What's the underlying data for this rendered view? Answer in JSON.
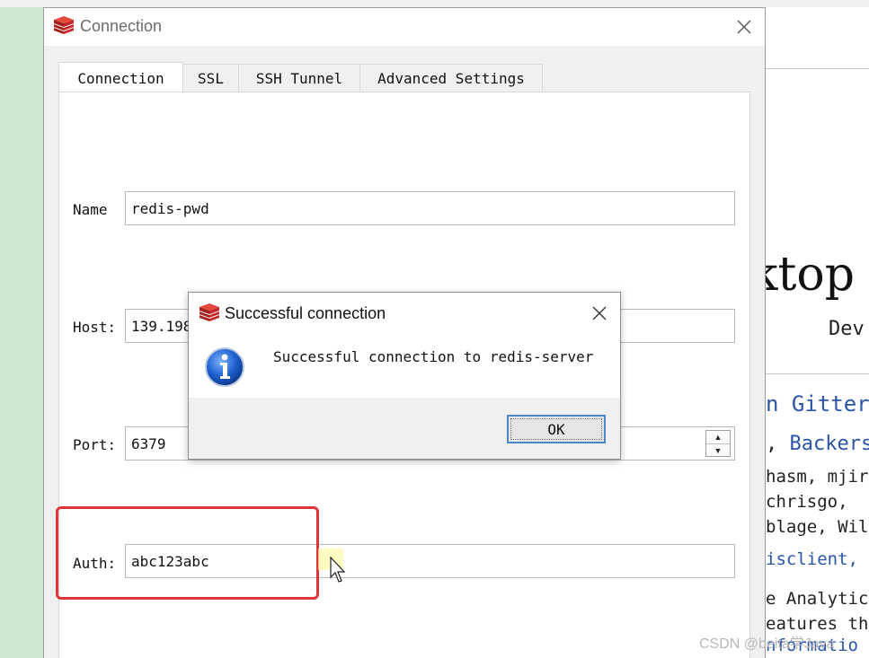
{
  "background": {
    "right_heading_fragment": "ktop",
    "right_sub_fragment": "Dev",
    "gitter_fragment": "n Gitter",
    "backers_prefix": ", ",
    "backers_fragment": "Backers",
    "line1": "hasm, mjir",
    "line2": " chrisgo,",
    "line3": "blage, Wil",
    "line4": "isclient, C",
    "line5": "e Analytics",
    "line6": "eatures tha",
    "line7": "nformatio",
    "watermark": "CSDN @beita学Java"
  },
  "connection_window": {
    "title": "Connection",
    "tabs": [
      {
        "label": "Connection"
      },
      {
        "label": "SSL"
      },
      {
        "label": "SSH Tunnel"
      },
      {
        "label": "Advanced Settings"
      }
    ],
    "fields": {
      "name": {
        "label": "Name",
        "value": "redis-pwd"
      },
      "host": {
        "label": "Host:",
        "value": "139.198"
      },
      "port": {
        "label": "Port:",
        "value": "6379"
      },
      "auth": {
        "label": "Auth:",
        "value": "abc123abc"
      }
    },
    "colors": {
      "highlight": "#e0343b",
      "redis_red": "#c8272c"
    }
  },
  "success_dialog": {
    "title": "Successful connection",
    "message": "Successful connection to redis-server",
    "ok_label": "OK",
    "icon": "info-icon"
  }
}
